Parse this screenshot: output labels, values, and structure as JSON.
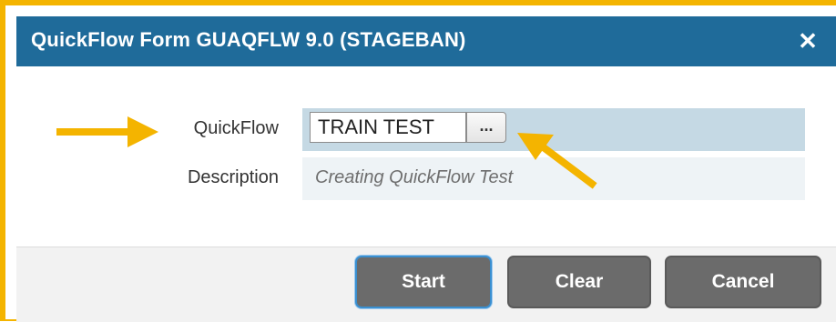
{
  "dialog": {
    "title": "QuickFlow Form GUAQFLW 9.0 (STAGEBAN)",
    "close_icon": "close-icon"
  },
  "form": {
    "quickflow_label": "QuickFlow",
    "quickflow_value": "TRAIN TEST",
    "lookup_label": "...",
    "description_label": "Description",
    "description_value": "Creating QuickFlow Test"
  },
  "footer": {
    "start_label": "Start",
    "clear_label": "Clear",
    "cancel_label": "Cancel"
  },
  "colors": {
    "highlight_arrows": "#f4b400",
    "titlebar": "#1f6b9a",
    "button": "#6b6b6b"
  }
}
